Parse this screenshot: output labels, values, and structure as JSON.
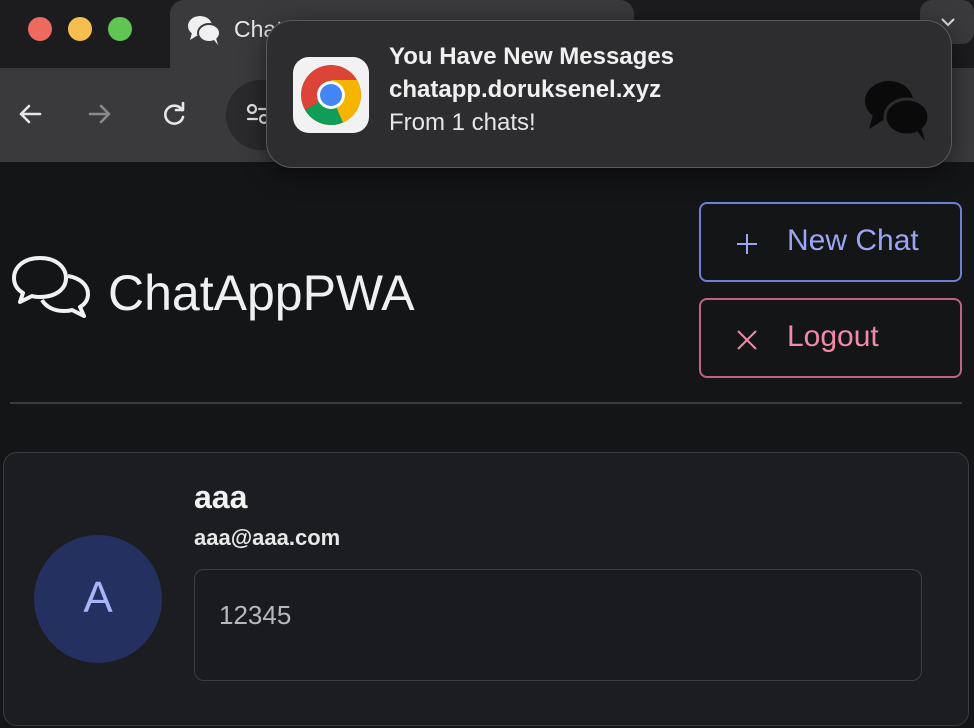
{
  "browser": {
    "tab_title": "ChatAppPWA",
    "tab_extra": "+",
    "colors": {
      "close": "#ed6a5e",
      "minimize": "#f5bf4f",
      "zoom": "#61c554"
    }
  },
  "notification": {
    "title": "You Have New Messages",
    "site": "chatapp.doruksenel.xyz",
    "body": "From 1 chats!",
    "icon": "chrome-icon",
    "app_icon": "chat-bubbles-icon"
  },
  "app": {
    "brand_name": "ChatAppPWA",
    "brand_icon": "chat-bubbles-icon",
    "new_chat_label": "New Chat",
    "logout_label": "Logout",
    "accent": "#9aa6f4",
    "danger": "#f08aa8"
  },
  "chats": [
    {
      "avatar_letter": "A",
      "name": "aaa",
      "email": "aaa@aaa.com",
      "last_message": "12345"
    }
  ]
}
